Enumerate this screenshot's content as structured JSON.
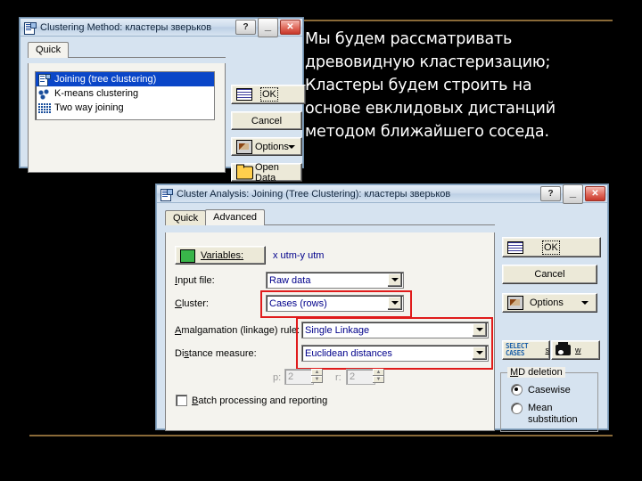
{
  "slide": {
    "background_color": "#000000",
    "rule_color": "#8a6a38",
    "caption": "Мы будем рассматривать\nдревовидную кластеризацию;\nКластеры будем строить на\nоснове евклидовых дистанций\nметодом ближайшего соседа."
  },
  "dialog1": {
    "title": "Clustering Method: кластеры зверьков",
    "caption_buttons": {
      "help": "?",
      "minimize": "—",
      "close": "✕"
    },
    "tabs": [
      {
        "label": "Quick",
        "selected": true
      }
    ],
    "list_items": [
      {
        "label": "Joining (tree clustering)",
        "icon": "tree-icon",
        "selected": true
      },
      {
        "label": "K-means clustering",
        "icon": "kmeans-icon",
        "selected": false
      },
      {
        "label": "Two way joining",
        "icon": "grid-icon",
        "selected": false
      }
    ],
    "buttons": {
      "ok": "OK",
      "cancel": "Cancel",
      "options": "Options",
      "options_caret": "▼",
      "open_data": "Open Data",
      "select_cases": "SELECT CASES",
      "select_cases_key": "s",
      "print_key": "w"
    }
  },
  "dialog2": {
    "title": "Cluster Analysis: Joining (Tree Clustering): кластеры зверьков",
    "caption_buttons": {
      "help": "?",
      "minimize": "—",
      "close": "✕"
    },
    "tabs": [
      {
        "label": "Quick",
        "selected": false
      },
      {
        "label": "Advanced",
        "selected": true
      }
    ],
    "variables": {
      "button_label": "Variables:",
      "value": "x utm-y utm"
    },
    "fields": [
      {
        "label": "Input file:",
        "value": "Raw data",
        "highlighted": false
      },
      {
        "label": "Cluster:",
        "value": "Cases (rows)",
        "highlighted": true
      },
      {
        "label": "Amalgamation (linkage) rule:",
        "value": "Single Linkage",
        "highlighted": true
      },
      {
        "label": "Distance measure:",
        "value": "Euclidean distances",
        "highlighted": true
      }
    ],
    "power_params": [
      {
        "label": "p:",
        "value": "2"
      },
      {
        "label": "r:",
        "value": "2"
      }
    ],
    "batch_checkbox": {
      "label": "Batch processing and reporting",
      "checked": false
    },
    "buttons": {
      "ok": "OK",
      "cancel": "Cancel",
      "options": "Options",
      "options_caret": "▼",
      "select_cases": "SELECT CASES",
      "select_cases_key": "s",
      "print_key": "w"
    },
    "md_deletion": {
      "title": "MD deletion",
      "options": [
        {
          "label": "Casewise",
          "selected": true
        },
        {
          "label": "Mean substitution",
          "selected": false
        }
      ]
    },
    "highlight_color": "#e01b1b"
  }
}
